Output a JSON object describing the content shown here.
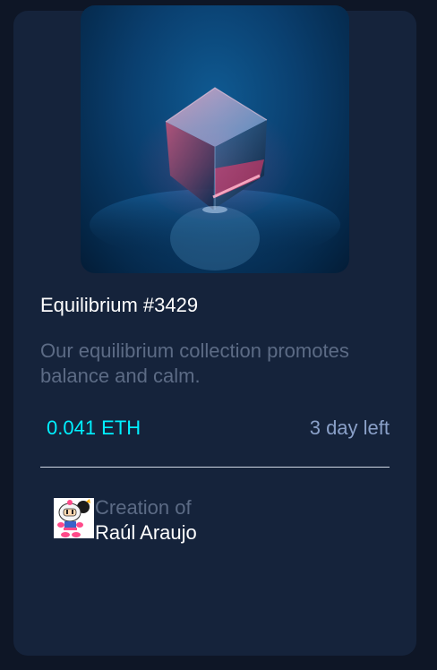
{
  "card": {
    "image_alt": "equilibrium cube",
    "title": "Equilibrium #3429",
    "description": "Our equilibrium collection promotes balance and calm.",
    "price": "0.041 ETH",
    "time_left": "3 day left",
    "creator_label": "Creation of",
    "creator_name": "Raúl Araujo"
  },
  "colors": {
    "background": "#0e1626",
    "card": "#15233b",
    "accent_cyan": "#00f0ff",
    "soft_blue": "#8aa0c8",
    "muted_text": "#5c6b85"
  },
  "icons": {
    "price": "ethereum-icon",
    "time": "clock-icon"
  }
}
